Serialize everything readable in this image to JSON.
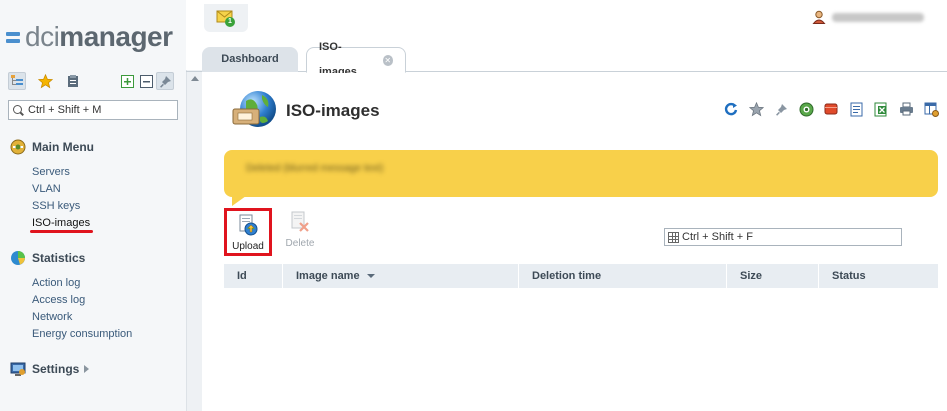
{
  "app": {
    "logo_light": "dci",
    "logo_bold": "manager",
    "notifications_count": "1",
    "username": "administrator"
  },
  "sidebar": {
    "search_placeholder": "Ctrl + Shift + M",
    "tools": [
      "tree-view-icon",
      "favorites-star-icon",
      "clipboard-icon",
      "expand-all-icon",
      "collapse-all-icon",
      "pin-icon"
    ],
    "sections": {
      "main_menu": {
        "title": "Main Menu",
        "items": [
          "Servers",
          "VLAN",
          "SSH keys",
          "ISO-images"
        ]
      },
      "statistics": {
        "title": "Statistics",
        "items": [
          "Action log",
          "Access log",
          "Network",
          "Energy consumption"
        ]
      },
      "settings": {
        "title": "Settings"
      }
    }
  },
  "tabs": {
    "dashboard": "Dashboard",
    "iso": "ISO-images"
  },
  "page": {
    "title": "ISO-images",
    "banner_text": "Deleted (blurred message text)",
    "actions": {
      "upload": "Upload",
      "delete": "Delete"
    },
    "grid_search_placeholder": "Ctrl + Shift + F",
    "columns": [
      "Id",
      "Image name",
      "Deletion time",
      "Size",
      "Status"
    ]
  },
  "colors": {
    "banner": "#f8d04a",
    "highlight": "#e0141e",
    "header_row": "#e8edf2"
  }
}
